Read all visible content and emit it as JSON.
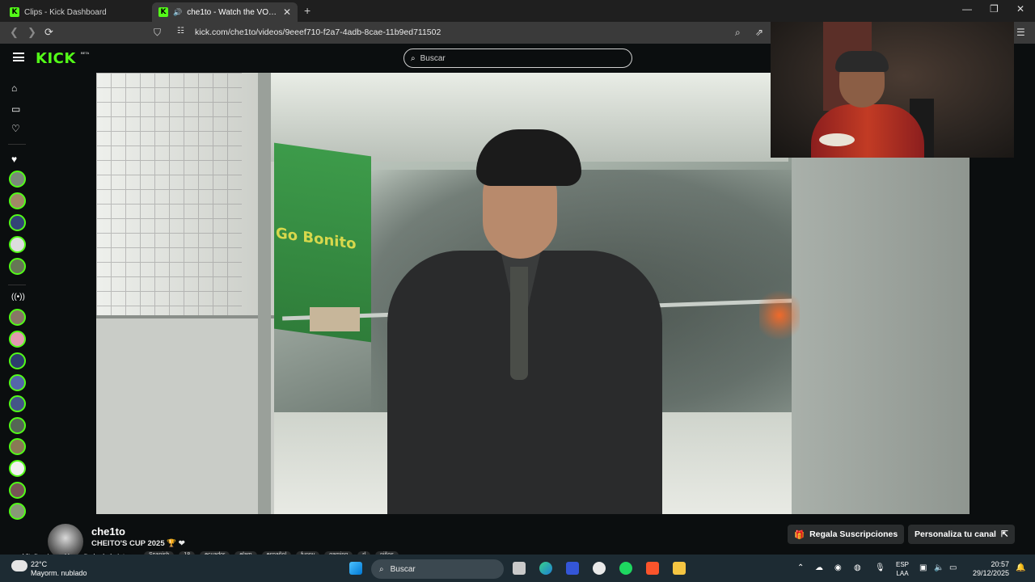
{
  "tabs": [
    {
      "title": "Clips - Kick Dashboard"
    },
    {
      "title": "che1to - Watch the VOD on K"
    }
  ],
  "address_bar": {
    "url": "kick.com/che1to/videos/9eeef710-f2a7-4adb-8cae-11b9ed711502"
  },
  "header": {
    "logo": "KICK",
    "logo_badge": "BETA",
    "search_placeholder": "Buscar"
  },
  "video": {
    "banner_text": "Go Bonito"
  },
  "channel": {
    "name": "che1to",
    "title": "CHEITO'S CUP 2025 🏆 ❤",
    "tags": [
      "Spanish",
      "18",
      "ecuador",
      "elam",
      "español",
      "funny",
      "gaming",
      "rl",
      "niños"
    ],
    "gift_button": "Regala Suscripciones",
    "customize_button": "Personaliza tu canal"
  },
  "chat_overlay": {
    "user": "Vitaliaruizzz",
    "message": "Y ese lindo de la intro"
  },
  "taskbar": {
    "weather_temp": "22°C",
    "weather_desc": "Mayorm. nublado",
    "search_placeholder": "Buscar",
    "lang_line1": "ESP",
    "lang_line2": "LAA",
    "time": "20:57",
    "date": "29/12/2025"
  },
  "colors": {
    "accent": "#53fc18",
    "background": "#0b0e0f"
  }
}
